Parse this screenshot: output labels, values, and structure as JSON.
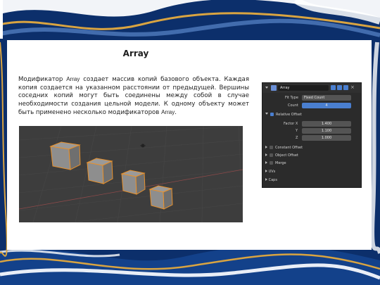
{
  "slide": {
    "title": "Array",
    "body_part1": "Модификатор ",
    "body_term1": "Array",
    "body_part2": " создает массив копий базового объекта. Каждая копия создается на указанном расстоянии от предыдущей. Вершины соседних копий могут быть соединены между собой в случае необходимости создания цельной модели. К одному объекту может быть применено несколько модификаторов ",
    "body_term2": "Array",
    "body_part3": "."
  },
  "modifier_panel": {
    "name_value": "Array",
    "fit_type_label": "Fit Type",
    "fit_type_value": "Fixed Count",
    "count_label": "Count",
    "count_value": "4",
    "relative_offset_label": "Relative Offset",
    "factor_x_label": "Factor X",
    "factor_x_value": "1.400",
    "y_label": "Y",
    "y_value": "1.100",
    "z_label": "Z",
    "z_value": "1.000",
    "constant_offset_label": "Constant Offset",
    "object_offset_label": "Object Offset",
    "merge_label": "Merge",
    "uvs_label": "UVs",
    "caps_label": "Caps"
  },
  "colors": {
    "background_blue": "#0c2f6b",
    "accent_gold": "#d9a441",
    "panel_dark": "#2b2b2b",
    "viewport_grey": "#3d3d3d",
    "cube_outline": "#e8912c",
    "checkbox_on": "#4a7fd0"
  }
}
